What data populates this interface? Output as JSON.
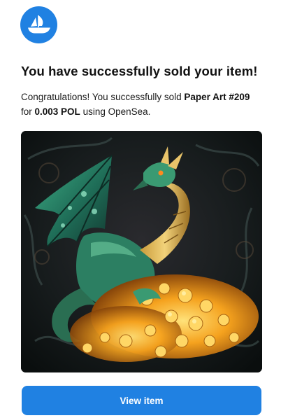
{
  "brand": {
    "logo_icon": "opensea-ship-icon",
    "color": "#2081e2"
  },
  "email": {
    "headline": "You have successfully sold your item!",
    "message_prefix": "Congratulations! You successfully sold ",
    "item_name": "Paper Art #209",
    "message_middle": "for ",
    "price": "0.003 POL",
    "message_suffix": " using OpenSea."
  },
  "image": {
    "icon": "dragon-artwork-image"
  },
  "actions": {
    "view_item_label": "View item"
  }
}
